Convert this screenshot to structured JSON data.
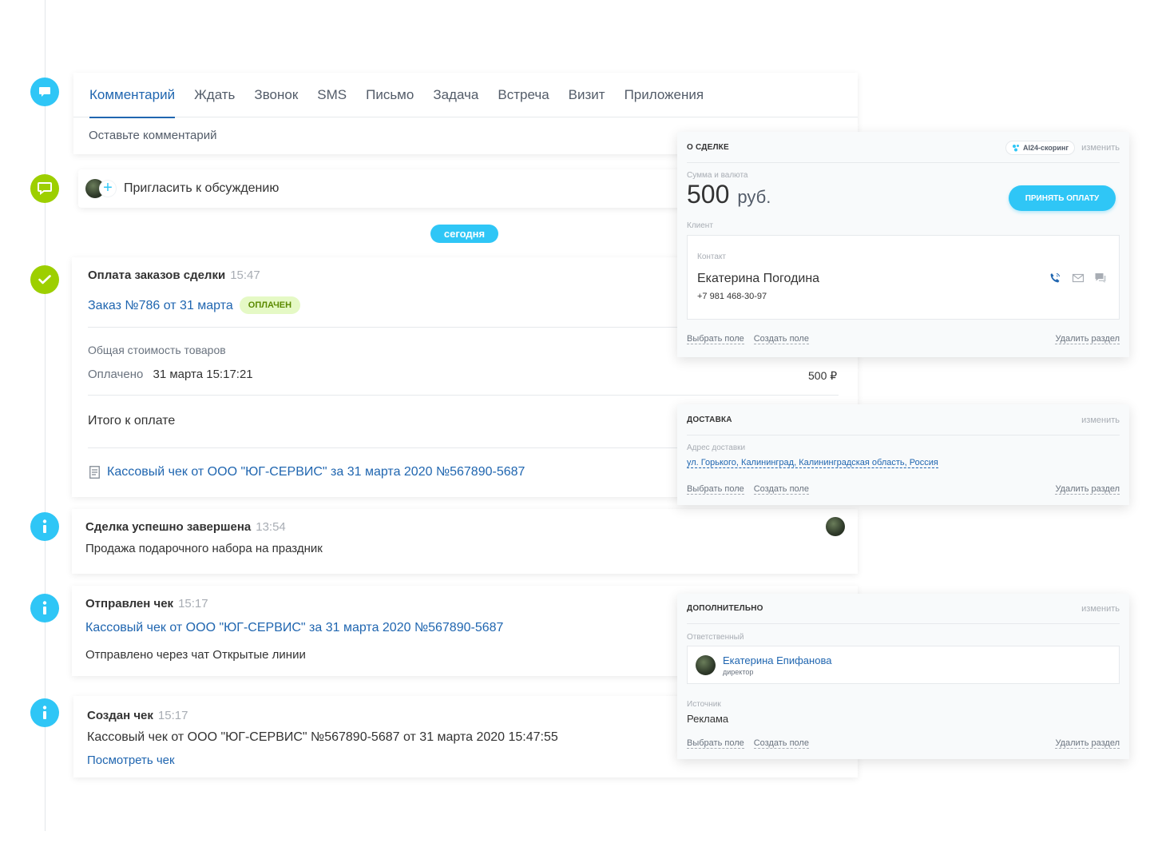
{
  "composer": {
    "tabs": [
      "Комментарий",
      "Ждать",
      "Звонок",
      "SMS",
      "Письмо",
      "Задача",
      "Встреча",
      "Визит",
      "Приложения"
    ],
    "placeholder": "Оставьте комментарий"
  },
  "invite": {
    "label": "Пригласить к обсуждению"
  },
  "today": "сегодня",
  "payment": {
    "title": "Оплата заказов сделки",
    "time": "15:47",
    "order_link": "Заказ №786 от 31 марта",
    "status": "оплачен",
    "total_goods_label": "Общая стоимость товаров",
    "paid_label": "Оплачено",
    "paid_date": "31 марта 15:17:21",
    "paid_amount": "500 ₽",
    "total_due_label": "Итого к оплате",
    "receipt_link": "Кассовый чек от ООО \"ЮГ-СЕРВИС\" за 31 марта 2020 №567890-5687"
  },
  "events": {
    "deal_done": {
      "title": "Сделка успешно завершена",
      "time": "13:54",
      "text": "Продажа подарочного набора на праздник"
    },
    "check_sent": {
      "title": "Отправлен чек",
      "time": "15:17",
      "link": "Кассовый чек от ООО \"ЮГ-СЕРВИС\" за 31 марта 2020 №567890-5687",
      "text": "Отправлено через чат Открытые линии"
    },
    "check_created": {
      "title": "Создан чек",
      "time": "15:17",
      "text": "Кассовый чек от ООО \"ЮГ-СЕРВИС\" №567890-5687 от 31 марта 2020 15:47:55",
      "link": "Посмотреть чек"
    }
  },
  "deal_panel": {
    "title": "о сделке",
    "scoring": "AI24-скоринг",
    "edit": "изменить",
    "amount_label": "Сумма и валюта",
    "amount": "500",
    "currency": "руб.",
    "accept_button": "Принять оплату",
    "client_label": "Клиент",
    "contact_label": "Контакт",
    "contact_name": "Екатерина Погодина",
    "contact_phone": "+7 981 468-30-97",
    "select_field": "Выбрать поле",
    "create_field": "Создать поле",
    "delete_section": "Удалить раздел"
  },
  "delivery_panel": {
    "title": "доставка",
    "edit": "изменить",
    "address_label": "Адрес доставки",
    "address": "ул. Горького, Калининград, Калининградская область, Россия",
    "select_field": "Выбрать поле",
    "create_field": "Создать поле",
    "delete_section": "Удалить раздел"
  },
  "extra_panel": {
    "title": "дополнительно",
    "edit": "изменить",
    "responsible_label": "Ответственный",
    "responsible_name": "Екатерина Епифанова",
    "responsible_role": "директор",
    "source_label": "Источник",
    "source_value": "Реклама",
    "select_field": "Выбрать поле",
    "create_field": "Создать поле",
    "delete_section": "Удалить раздел"
  },
  "colors": {
    "accent_blue": "#2fc6f6",
    "link_blue": "#2066b0",
    "green": "#9dcf00"
  }
}
